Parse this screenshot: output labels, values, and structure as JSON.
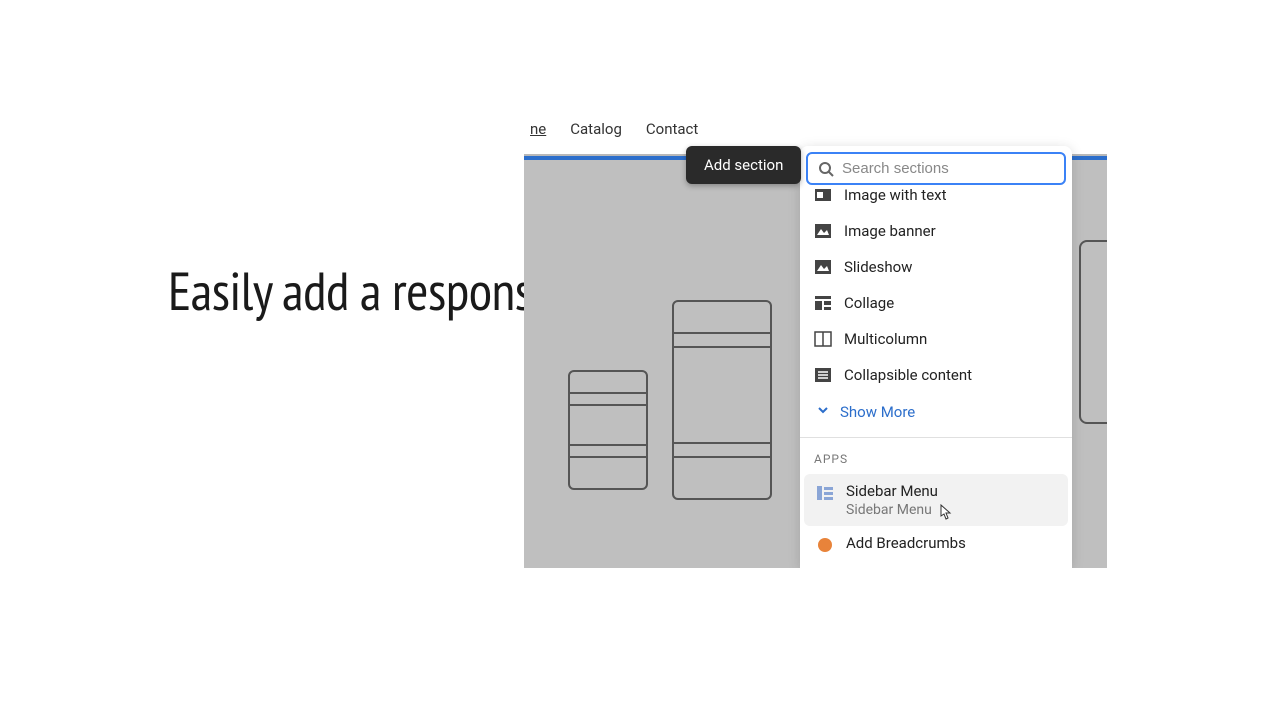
{
  "heading": "Easily add a responsive Sidebar Menu",
  "nav": {
    "items": [
      "ne",
      "Catalog",
      "Contact"
    ]
  },
  "tooltip": "Add section",
  "search": {
    "placeholder": "Search sections"
  },
  "sections": [
    {
      "label": "Image with text",
      "icon": "image-text"
    },
    {
      "label": "Image banner",
      "icon": "image"
    },
    {
      "label": "Slideshow",
      "icon": "image"
    },
    {
      "label": "Collage",
      "icon": "collage"
    },
    {
      "label": "Multicolumn",
      "icon": "columns"
    },
    {
      "label": "Collapsible content",
      "icon": "list"
    }
  ],
  "show_more": "Show More",
  "apps_header": "APPS",
  "apps": [
    {
      "title": "Sidebar Menu",
      "sub": "Sidebar Menu",
      "icon": "sidebar",
      "hovered": true
    },
    {
      "title": "Add Breadcrumbs",
      "sub": "",
      "icon": "breadcrumb",
      "hovered": false
    }
  ]
}
